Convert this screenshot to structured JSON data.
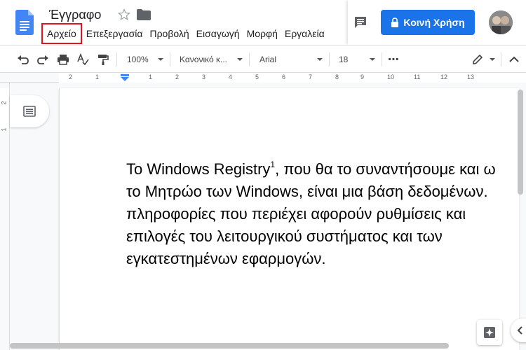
{
  "document": {
    "title": "Έγγραφο"
  },
  "menubar": {
    "items": [
      {
        "label": "Αρχείο"
      },
      {
        "label": "Επεξεργασία"
      },
      {
        "label": "Προβολή"
      },
      {
        "label": "Εισαγωγή"
      },
      {
        "label": "Μορφή"
      },
      {
        "label": "Εργαλεία"
      }
    ]
  },
  "share": {
    "label": "Κοινή Χρήση"
  },
  "toolbar": {
    "zoom": "100%",
    "style": "Κανονικό κ...",
    "font": "Arial",
    "font_size": "18",
    "more": "⋯"
  },
  "ruler": {
    "numbers": [
      "2",
      "1",
      "1",
      "2",
      "3",
      "4",
      "5",
      "6",
      "7",
      "8",
      "9",
      "10",
      "11",
      "12",
      "13"
    ]
  },
  "vruler": {
    "numbers": [
      "2",
      "1"
    ]
  },
  "page": {
    "lines": [
      "Το Windows Registry",
      "το Μητρώο των Windows, είναι μια βάση δεδομένων.",
      "πληροφορίες που περιέχει αφορούν ρυθμίσεις και",
      "επιλογές του λειτουργικού συστήματος και των",
      "εγκατεστημένων εφαρμογών."
    ],
    "footnote_ref": "1",
    "line1_rest": ", που θα το συναντήσουμε και ω"
  },
  "colors": {
    "accent": "#1a73e8",
    "highlight": "#e0141c"
  }
}
